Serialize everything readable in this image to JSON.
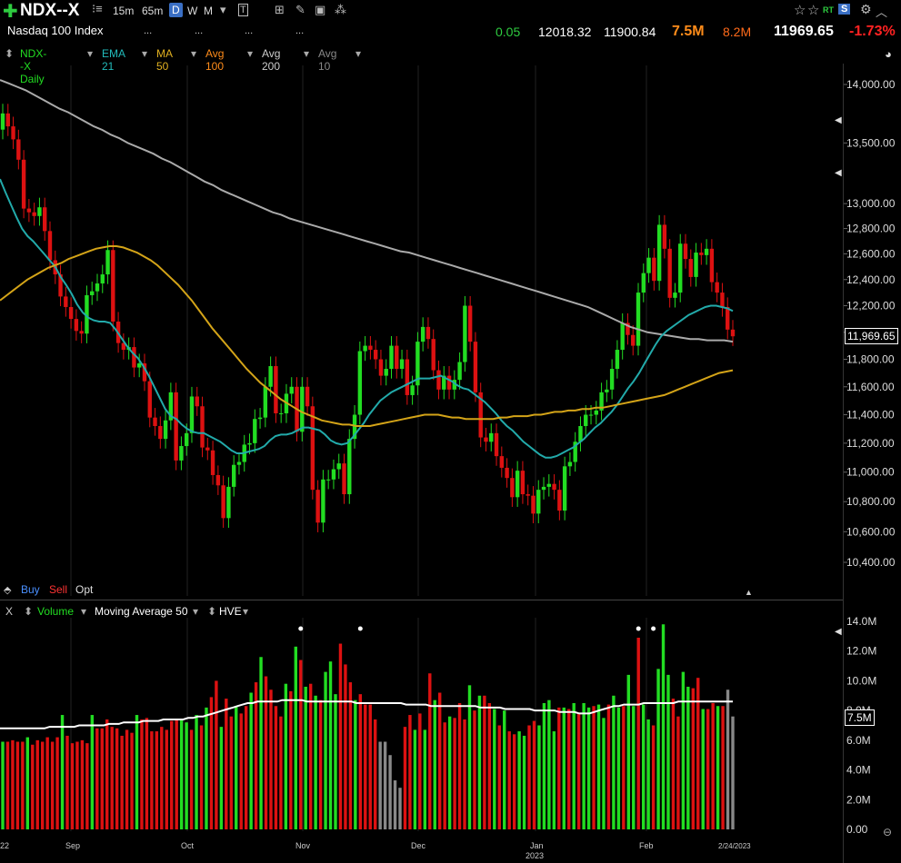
{
  "toolbar": {
    "symbol": "NDX--X",
    "timeframes": [
      "15m",
      "65m",
      "D",
      "W",
      "M"
    ],
    "selected_timeframe": "D",
    "name": "Nasdaq 100 Index",
    "dots1": "...",
    "dots2": "...",
    "dots3": "...",
    "dots4": "...",
    "change": "0.05",
    "high": "12018.32",
    "low": "11900.84",
    "volume": "7.5M",
    "avg_volume": "8.2M",
    "last": "11969.65",
    "pct_change": "-1.73%",
    "rt_label": "RT",
    "s_label": "S"
  },
  "indicators": {
    "symbol_daily": "NDX--X Daily",
    "ema21": "EMA 21",
    "ma50": "MA 50",
    "avg100": "Avg 100",
    "avg200": "Avg 200",
    "avg10": "Avg 10"
  },
  "orders": {
    "buy": "Buy",
    "sell": "Sell",
    "opt": "Opt"
  },
  "volume_header": {
    "x": "X",
    "volume": "Volume",
    "ma": "Moving Average 50",
    "hve": "HVE"
  },
  "price_label": "11,969.65",
  "volume_label": "7.5M",
  "colors": {
    "up": "#22dd22",
    "down": "#dd1111",
    "ema21": "#22aaaa",
    "ma50": "#d4a418",
    "avg200": "#aaaaaa",
    "vol_ma": "#ffffff",
    "neutral": "#888888"
  },
  "chart_data": [
    {
      "type": "candlestick",
      "title": "NDX--X Daily",
      "y_ticks": [
        "14,000.00",
        "13,500.00",
        "13,000.00",
        "12,800.00",
        "12,600.00",
        "12,400.00",
        "12,200.00",
        "12,000.00",
        "11,800.00",
        "11,600.00",
        "11,400.00",
        "11,200.00",
        "11,000.00",
        "10,800.00",
        "10,600.00",
        "10,400.00"
      ],
      "y_tick_values": [
        14000,
        13500,
        13000,
        12800,
        12600,
        12400,
        12200,
        12000,
        11800,
        11600,
        11400,
        11200,
        11000,
        10800,
        10600,
        10400
      ],
      "y_scale": "log",
      "x_labels": [
        "22",
        "Sep",
        "Oct",
        "Nov",
        "Dec",
        "Jan",
        "2023",
        "Feb",
        "2/24/2023"
      ],
      "x_label_dates": [
        "2022-08-22",
        "2022-09-01",
        "2022-10-03",
        "2022-11-01",
        "2022-12-01",
        "2023-01-03",
        "2023-01-03",
        "2023-02-01",
        "2023-02-24"
      ],
      "closes": [
        13750,
        13640,
        13530,
        13360,
        12960,
        12930,
        12900,
        12970,
        12780,
        12550,
        12440,
        12270,
        12190,
        12100,
        12010,
        11990,
        12280,
        12310,
        12370,
        12440,
        12630,
        12080,
        11920,
        11870,
        11890,
        11740,
        11770,
        11640,
        11380,
        11320,
        11230,
        11360,
        11560,
        11080,
        11180,
        11270,
        11530,
        11460,
        11170,
        11150,
        10980,
        10910,
        10690,
        10900,
        11050,
        11070,
        11190,
        11200,
        11370,
        11380,
        11600,
        11750,
        11410,
        11410,
        11550,
        11600,
        11280,
        11600,
        11460,
        10880,
        10660,
        10950,
        10950,
        11020,
        11060,
        10850,
        11230,
        11400,
        11860,
        11900,
        11870,
        11800,
        11680,
        11730,
        11900,
        11730,
        11800,
        11540,
        11610,
        11930,
        12040,
        11950,
        11720,
        11580,
        11680,
        11580,
        11650,
        11780,
        12200,
        11930,
        11560,
        11240,
        11210,
        11270,
        11110,
        11030,
        10960,
        10830,
        11010,
        10850,
        10840,
        10720,
        10880,
        10900,
        10920,
        10880,
        10740,
        11040,
        11070,
        11210,
        11320,
        11400,
        11400,
        11430,
        11560,
        11580,
        11730,
        11870,
        12070,
        11980,
        11900,
        12300,
        12450,
        12570,
        12390,
        12830,
        12640,
        12260,
        12300,
        12680,
        12560,
        12420,
        12610,
        12590,
        12640,
        12380,
        12300,
        12190,
        12020,
        11970
      ],
      "ema21": [
        13200,
        13090,
        12990,
        12890,
        12800,
        12740,
        12700,
        12650,
        12600,
        12550,
        12500,
        12420,
        12360,
        12290,
        12210,
        12150,
        12110,
        12090,
        12080,
        12080,
        12070,
        12020,
        11960,
        11900,
        11850,
        11810,
        11750,
        11680,
        11600,
        11520,
        11440,
        11390,
        11370,
        11330,
        11300,
        11280,
        11270,
        11270,
        11250,
        11230,
        11210,
        11180,
        11150,
        11130,
        11130,
        11140,
        11150,
        11160,
        11180,
        11220,
        11250,
        11260,
        11260,
        11270,
        11290,
        11310,
        11310,
        11300,
        11290,
        11260,
        11220,
        11200,
        11190,
        11200,
        11240,
        11290,
        11340,
        11400,
        11450,
        11500,
        11530,
        11560,
        11580,
        11600,
        11620,
        11640,
        11660,
        11660,
        11660,
        11670,
        11680,
        11660,
        11640,
        11610,
        11590,
        11580,
        11550,
        11520,
        11490,
        11450,
        11410,
        11360,
        11320,
        11290,
        11250,
        11210,
        11180,
        11150,
        11120,
        11100,
        11100,
        11110,
        11130,
        11150,
        11170,
        11200,
        11230,
        11270,
        11310,
        11340,
        11380,
        11420,
        11470,
        11530,
        11590,
        11640,
        11700,
        11770,
        11840,
        11910,
        11970,
        12010,
        12040,
        12070,
        12100,
        12130,
        12150,
        12170,
        12190,
        12200,
        12200,
        12190,
        12180,
        12160
      ],
      "ma50": [
        12240,
        12280,
        12320,
        12360,
        12400,
        12430,
        12460,
        12490,
        12510,
        12530,
        12560,
        12580,
        12600,
        12620,
        12640,
        12650,
        12660,
        12660,
        12650,
        12630,
        12610,
        12580,
        12550,
        12510,
        12460,
        12410,
        12360,
        12300,
        12240,
        12170,
        12100,
        12030,
        11970,
        11910,
        11850,
        11790,
        11730,
        11680,
        11630,
        11590,
        11550,
        11510,
        11480,
        11450,
        11420,
        11400,
        11380,
        11360,
        11350,
        11340,
        11330,
        11330,
        11320,
        11320,
        11320,
        11330,
        11340,
        11350,
        11360,
        11370,
        11380,
        11390,
        11400,
        11400,
        11400,
        11390,
        11380,
        11380,
        11370,
        11370,
        11370,
        11370,
        11370,
        11380,
        11380,
        11390,
        11390,
        11390,
        11400,
        11400,
        11410,
        11420,
        11420,
        11430,
        11430,
        11440,
        11440,
        11450,
        11450,
        11460,
        11470,
        11480,
        11490,
        11500,
        11510,
        11520,
        11530,
        11540,
        11560,
        11580,
        11600,
        11620,
        11640,
        11660,
        11680,
        11700,
        11710,
        11720
      ],
      "avg200": [
        14040,
        14010,
        13980,
        13950,
        13910,
        13870,
        13830,
        13790,
        13760,
        13720,
        13680,
        13640,
        13610,
        13570,
        13540,
        13500,
        13470,
        13440,
        13410,
        13370,
        13340,
        13300,
        13260,
        13220,
        13180,
        13150,
        13110,
        13080,
        13050,
        13020,
        12990,
        12960,
        12930,
        12910,
        12880,
        12860,
        12840,
        12820,
        12800,
        12780,
        12760,
        12740,
        12720,
        12700,
        12680,
        12660,
        12640,
        12620,
        12610,
        12590,
        12570,
        12550,
        12530,
        12510,
        12490,
        12470,
        12450,
        12430,
        12410,
        12390,
        12370,
        12350,
        12330,
        12310,
        12290,
        12270,
        12250,
        12230,
        12210,
        12190,
        12160,
        12130,
        12100,
        12070,
        12040,
        12020,
        12000,
        11990,
        11980,
        11970,
        11960,
        11950,
        11950,
        11940,
        11940,
        11940,
        11930
      ],
      "last": 11969.65
    },
    {
      "type": "bar",
      "title": "Volume",
      "y_ticks": [
        "14.0M",
        "12.0M",
        "10.0M",
        "8.0M",
        "6.0M",
        "4.0M",
        "2.0M",
        "0.00"
      ],
      "y_tick_values": [
        14,
        12,
        10,
        8,
        6,
        4,
        2,
        0
      ],
      "ylim": [
        0,
        14
      ],
      "unit": "M",
      "values": [
        5.9,
        5.9,
        6.0,
        5.9,
        5.9,
        6.2,
        5.7,
        6.0,
        5.9,
        6.2,
        5.9,
        6.2,
        7.7,
        6.3,
        5.8,
        5.9,
        6.0,
        5.8,
        7.7,
        6.8,
        6.8,
        7.4,
        6.9,
        6.8,
        6.3,
        6.7,
        6.5,
        7.7,
        7.4,
        7.5,
        6.6,
        6.6,
        6.9,
        6.7,
        7.3,
        7.4,
        7.4,
        7.2,
        6.7,
        7.7,
        7.0,
        8.2,
        8.9,
        10.0,
        6.9,
        8.8,
        7.6,
        8.3,
        7.8,
        8.3,
        9.2,
        9.9,
        11.6,
        10.3,
        9.4,
        8.3,
        7.6,
        9.8,
        9.3,
        12.3,
        11.4,
        9.6,
        9.8,
        9.0,
        8.7,
        10.6,
        11.3,
        9.1,
        12.5,
        11.1,
        9.9,
        8.7,
        9.1,
        8.4,
        8.4,
        7.4,
        5.9,
        5.9,
        5.0,
        3.3,
        2.8,
        6.9,
        7.7,
        6.7,
        7.8,
        6.7,
        10.5,
        8.7,
        9.2,
        7.2,
        7.6,
        7.5,
        8.5,
        7.4,
        9.7,
        8.0,
        9.0,
        9.0,
        8.5,
        8.1,
        7.0,
        8.0,
        6.6,
        6.4,
        6.6,
        6.3,
        7.0,
        7.3,
        7.0,
        8.5,
        8.7,
        6.6,
        8.2,
        8.2,
        8.1,
        8.5,
        7.8,
        8.5,
        8.2,
        8.3,
        8.4,
        7.5,
        8.4,
        9.0,
        8.2,
        8.3,
        10.4,
        8.3,
        12.9,
        8.4,
        7.4,
        7.0,
        10.8,
        13.8,
        10.4,
        8.8,
        7.6,
        10.6,
        9.6,
        9.5,
        10.2,
        8.1,
        8.1,
        8.5,
        8.3,
        8.3,
        9.4,
        7.6
      ],
      "direction": [
        "u",
        "d",
        "d",
        "d",
        "d",
        "u",
        "d",
        "d",
        "d",
        "d",
        "d",
        "d",
        "u",
        "d",
        "d",
        "d",
        "d",
        "d",
        "u",
        "d",
        "d",
        "d",
        "d",
        "d",
        "d",
        "d",
        "d",
        "u",
        "d",
        "d",
        "d",
        "d",
        "d",
        "d",
        "d",
        "d",
        "u",
        "u",
        "d",
        "u",
        "d",
        "u",
        "d",
        "d",
        "u",
        "d",
        "d",
        "u",
        "d",
        "d",
        "u",
        "d",
        "u",
        "d",
        "d",
        "d",
        "d",
        "u",
        "d",
        "u",
        "d",
        "u",
        "d",
        "u",
        "d",
        "u",
        "u",
        "u",
        "d",
        "d",
        "d",
        "u",
        "d",
        "d",
        "d",
        "d",
        "n",
        "n",
        "n",
        "n",
        "n",
        "d",
        "d",
        "u",
        "d",
        "u",
        "d",
        "u",
        "d",
        "d",
        "u",
        "d",
        "d",
        "d",
        "u",
        "d",
        "u",
        "d",
        "d",
        "u",
        "d",
        "u",
        "d",
        "d",
        "u",
        "u",
        "d",
        "d",
        "u",
        "u",
        "u",
        "u",
        "d",
        "u",
        "d",
        "u",
        "d",
        "u",
        "u",
        "d",
        "u",
        "u",
        "d",
        "u",
        "u",
        "d",
        "u",
        "u",
        "d",
        "u",
        "u",
        "d",
        "u",
        "u",
        "u",
        "d",
        "d",
        "u",
        "u",
        "d",
        "d",
        "u",
        "d",
        "d",
        "u",
        "d"
      ],
      "ma50": [
        6.8,
        6.8,
        6.8,
        6.8,
        6.8,
        6.8,
        6.8,
        6.8,
        6.8,
        6.8,
        6.9,
        6.9,
        6.9,
        6.9,
        6.9,
        6.9,
        7.0,
        7.0,
        7.0,
        7.0,
        7.0,
        7.0,
        7.1,
        7.1,
        7.1,
        7.2,
        7.2,
        7.2,
        7.2,
        7.3,
        7.3,
        7.3,
        7.3,
        7.4,
        7.4,
        7.4,
        7.4,
        7.4,
        7.5,
        7.5,
        7.6,
        7.6,
        7.7,
        7.8,
        7.9,
        8.0,
        8.1,
        8.2,
        8.3,
        8.4,
        8.5,
        8.5,
        8.6,
        8.6,
        8.6,
        8.6,
        8.6,
        8.7,
        8.7,
        8.7,
        8.7,
        8.7,
        8.6,
        8.6,
        8.6,
        8.6,
        8.6,
        8.6,
        8.6,
        8.6,
        8.6,
        8.6,
        8.5,
        8.5,
        8.5,
        8.5,
        8.5,
        8.5,
        8.5,
        8.5,
        8.5,
        8.5,
        8.4,
        8.4,
        8.4,
        8.4,
        8.4,
        8.3,
        8.3,
        8.3,
        8.3,
        8.3,
        8.3,
        8.3,
        8.3,
        8.3,
        8.3,
        8.2,
        8.2,
        8.2,
        8.2,
        8.2,
        8.1,
        8.1,
        8.1,
        8.1,
        8.1,
        8.1,
        8.0,
        8.0,
        8.0,
        8.0,
        8.0,
        7.9,
        7.9,
        7.9,
        7.9,
        7.8,
        7.8,
        7.8,
        7.9,
        8.0,
        8.1,
        8.2,
        8.3,
        8.3,
        8.4,
        8.4,
        8.4,
        8.4,
        8.5,
        8.5,
        8.5,
        8.5,
        8.5,
        8.5,
        8.5,
        8.6,
        8.6,
        8.6,
        8.6,
        8.6,
        8.6,
        8.6,
        8.6,
        8.6,
        8.6,
        8.6,
        8.6
      ],
      "hve_markers": [
        60,
        72,
        128,
        131
      ],
      "last": 7.5
    }
  ]
}
